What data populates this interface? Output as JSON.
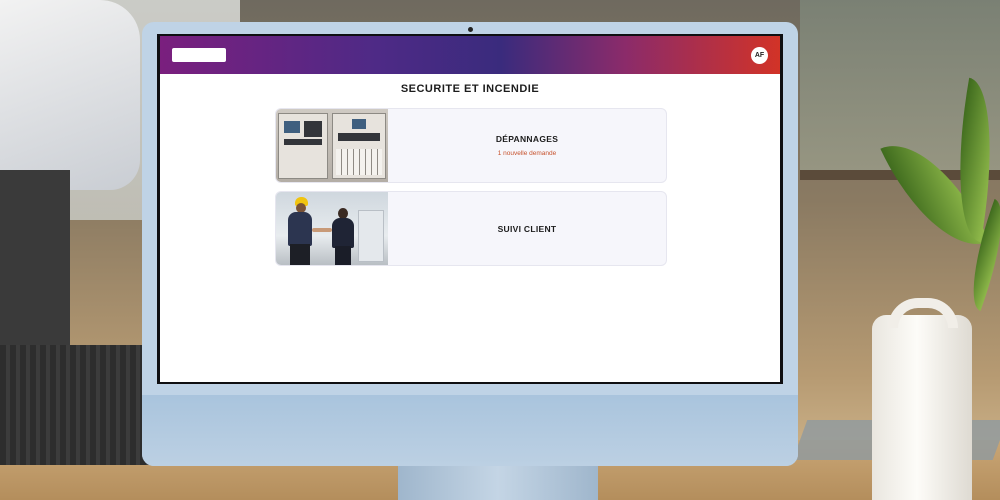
{
  "header": {
    "avatar_initials": "AF",
    "gradient_start": "#7a1f7e",
    "gradient_end": "#d23327"
  },
  "page": {
    "title": "SECURITE ET INCENDIE"
  },
  "cards": [
    {
      "title": "DÉPANNAGES",
      "subtitle": "1 nouvelle demande",
      "image": "electrical-panel-image"
    },
    {
      "title": "SUIVI CLIENT",
      "subtitle": "",
      "image": "handshake-workers-image"
    }
  ],
  "colors": {
    "subtitle_accent": "#c7532e"
  }
}
